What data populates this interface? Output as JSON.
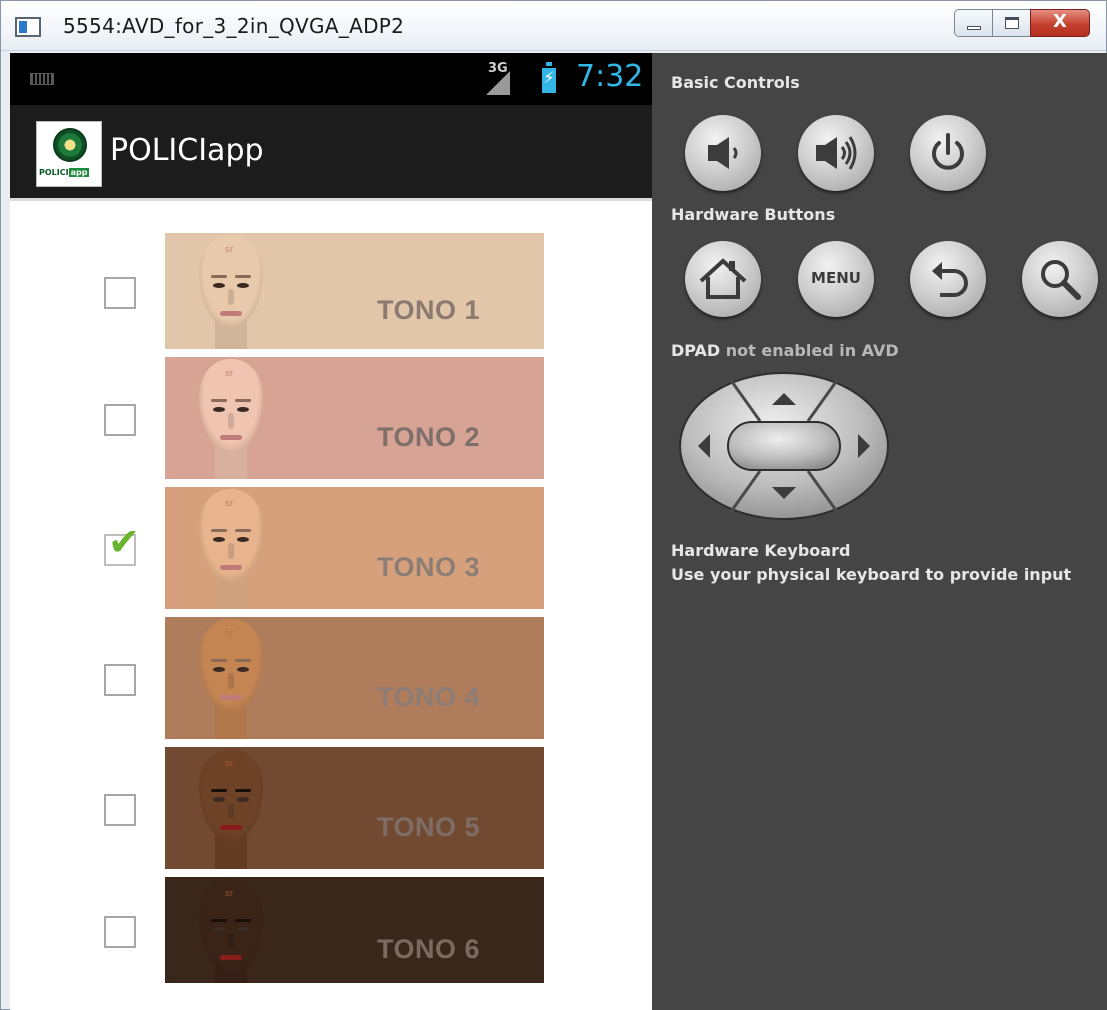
{
  "window": {
    "title": "5554:AVD_for_3_2in_QVGA_ADP2",
    "minimize_icon": "minimize-icon",
    "maximize_icon": "maximize-icon",
    "close_icon": "close-icon",
    "close_glyph": "X"
  },
  "phone": {
    "status_bar": {
      "network": "3G",
      "time": "7:32",
      "colors": {
        "accent": "#33b5e5",
        "background": "#000000"
      }
    },
    "action_bar": {
      "app_name": "POLICIapp",
      "logo_text": "POLICI",
      "logo_tag": "app"
    },
    "tones": [
      {
        "label": "TONO 1",
        "checked": false,
        "bg": "#e2c6aa",
        "text": "#8a7a70",
        "skin": "#e8c9ab",
        "swatch_h": 116
      },
      {
        "label": "TONO 2",
        "checked": false,
        "bg": "#d6a395",
        "text": "#7f6f6a",
        "skin": "#efc4b0",
        "swatch_h": 122
      },
      {
        "label": "TONO 3",
        "checked": true,
        "bg": "#d6a07c",
        "text": "#8c7e74",
        "skin": "#e7b48d",
        "swatch_h": 122
      },
      {
        "label": "TONO 4",
        "checked": false,
        "bg": "#b07d5c",
        "text": "#8e7d76",
        "skin": "#c48553",
        "swatch_h": 122
      },
      {
        "label": "TONO 5",
        "checked": false,
        "bg": "#714a31",
        "text": "#7f6d65",
        "skin": "#6e4226",
        "swatch_h": 122
      },
      {
        "label": "TONO 6",
        "checked": false,
        "bg": "#3a271b",
        "text": "#796a62",
        "skin": "#3a2418",
        "swatch_h": 106
      }
    ]
  },
  "controls": {
    "basic_controls_label": "Basic Controls",
    "basic_buttons": [
      {
        "name": "volume-down-button",
        "icon": "volume-down-icon"
      },
      {
        "name": "volume-up-button",
        "icon": "volume-up-icon"
      },
      {
        "name": "power-button",
        "icon": "power-icon"
      }
    ],
    "hardware_buttons_label": "Hardware Buttons",
    "hardware_buttons": [
      {
        "name": "home-button",
        "icon": "home-icon"
      },
      {
        "name": "menu-button",
        "label": "MENU"
      },
      {
        "name": "back-button",
        "icon": "back-icon"
      },
      {
        "name": "search-button",
        "icon": "search-icon"
      }
    ],
    "dpad_label_strong": "DPAD",
    "dpad_label_rest": " not enabled in AVD",
    "keyboard_title": "Hardware Keyboard",
    "keyboard_hint": "Use your physical keyboard to provide input",
    "colors": {
      "panel": "#454545",
      "label": "#e6e6e6"
    }
  }
}
